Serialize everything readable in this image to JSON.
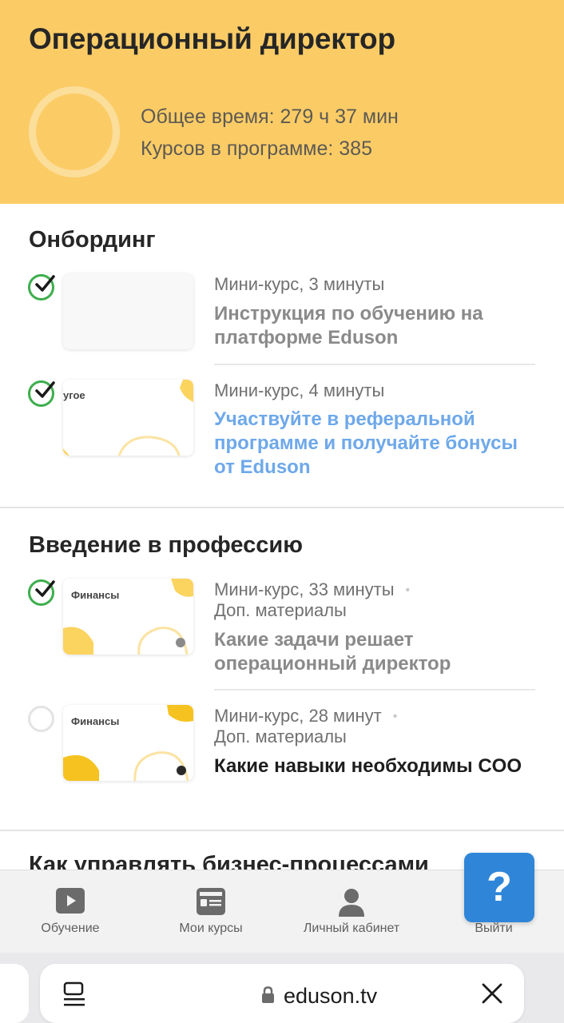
{
  "header": {
    "title": "Операционный директор",
    "total_time": "Общее время: 279 ч 37 мин",
    "courses_count": "Курсов в программе: 385"
  },
  "sections": [
    {
      "title": "Онбординг",
      "courses": [
        {
          "meta": "Мини-курс, 3 минуты",
          "title": "Инструкция по обучению на платформе Eduson",
          "completed": true,
          "thumb_label": ""
        },
        {
          "meta": "Мини-курс, 4 минуты",
          "title": "Участвуйте в реферальной программе и получайте бонусы от Eduson",
          "completed": true,
          "thumb_label": "угое"
        }
      ]
    },
    {
      "title": "Введение в профессию",
      "courses": [
        {
          "meta": "Мини-курс, 33 минуты",
          "extra": "Доп. материалы",
          "title": "Какие задачи решает операционный директор",
          "completed": true,
          "thumb_label": "Финансы"
        },
        {
          "meta": "Мини-курс, 28 минут",
          "extra": "Доп. материалы",
          "title": "Какие навыки необходимы COO",
          "completed": false,
          "thumb_label": "Финансы"
        }
      ]
    },
    {
      "title": "Как управлять бизнес-процессами"
    }
  ],
  "tabbar": {
    "items": [
      {
        "label": "Обучение",
        "icon": "play-icon"
      },
      {
        "label": "Мои курсы",
        "icon": "courses-card-icon"
      },
      {
        "label": "Личный кабинет",
        "icon": "user-icon"
      },
      {
        "label": "Выйти",
        "icon": "logout-icon"
      }
    ]
  },
  "help": {
    "label": "?"
  },
  "browser": {
    "url": "eduson.tv"
  },
  "colors": {
    "header_bg": "#fbcc66",
    "check_green": "#3dae4d",
    "link_blue": "#6ea8ea",
    "help_blue": "#2f86d8"
  }
}
